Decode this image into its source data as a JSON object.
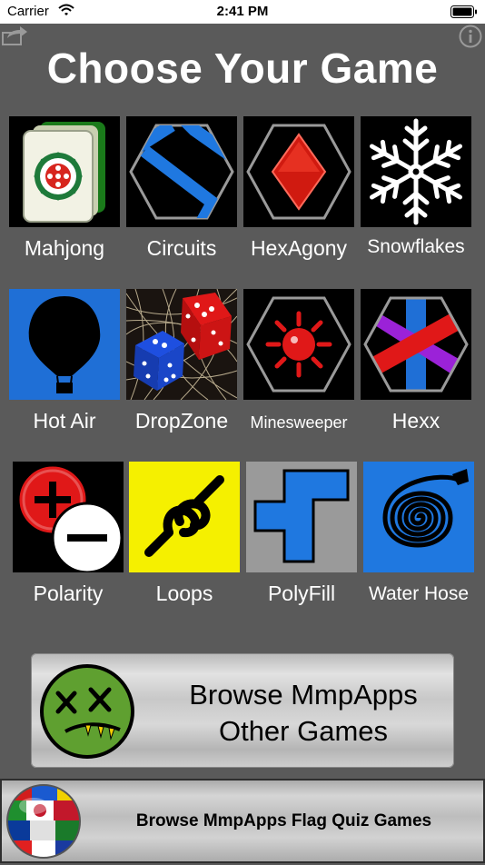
{
  "status_bar": {
    "carrier": "Carrier",
    "time": "2:41 PM"
  },
  "page": {
    "title": "Choose Your Game"
  },
  "games": [
    {
      "label": "Mahjong",
      "icon": "mahjong-tile-icon"
    },
    {
      "label": "Circuits",
      "icon": "circuits-icon"
    },
    {
      "label": "HexAgony",
      "icon": "hexagony-diamond-icon"
    },
    {
      "label": "Snowflakes",
      "icon": "snowflake-icon"
    },
    {
      "label": "Hot Air",
      "icon": "hot-air-balloon-icon"
    },
    {
      "label": "DropZone",
      "icon": "dice-icon"
    },
    {
      "label": "Minesweeper",
      "icon": "mine-icon"
    },
    {
      "label": "Hexx",
      "icon": "hexx-cross-icon"
    },
    {
      "label": "Polarity",
      "icon": "polarity-plus-minus-icon"
    },
    {
      "label": "Loops",
      "icon": "loops-chain-icon"
    },
    {
      "label": "PolyFill",
      "icon": "polyfill-shape-icon"
    },
    {
      "label": "Water Hose",
      "icon": "water-hose-icon"
    }
  ],
  "browse_other": {
    "line1": "Browse MmpApps",
    "line2": "Other Games"
  },
  "browse_flags": {
    "label": "Browse MmpApps Flag Quiz Games"
  },
  "colors": {
    "background": "#5a5a5a",
    "tile_blue": "#1f6fd6",
    "accent_red": "#e01818",
    "loops_yellow": "#f5f000"
  }
}
